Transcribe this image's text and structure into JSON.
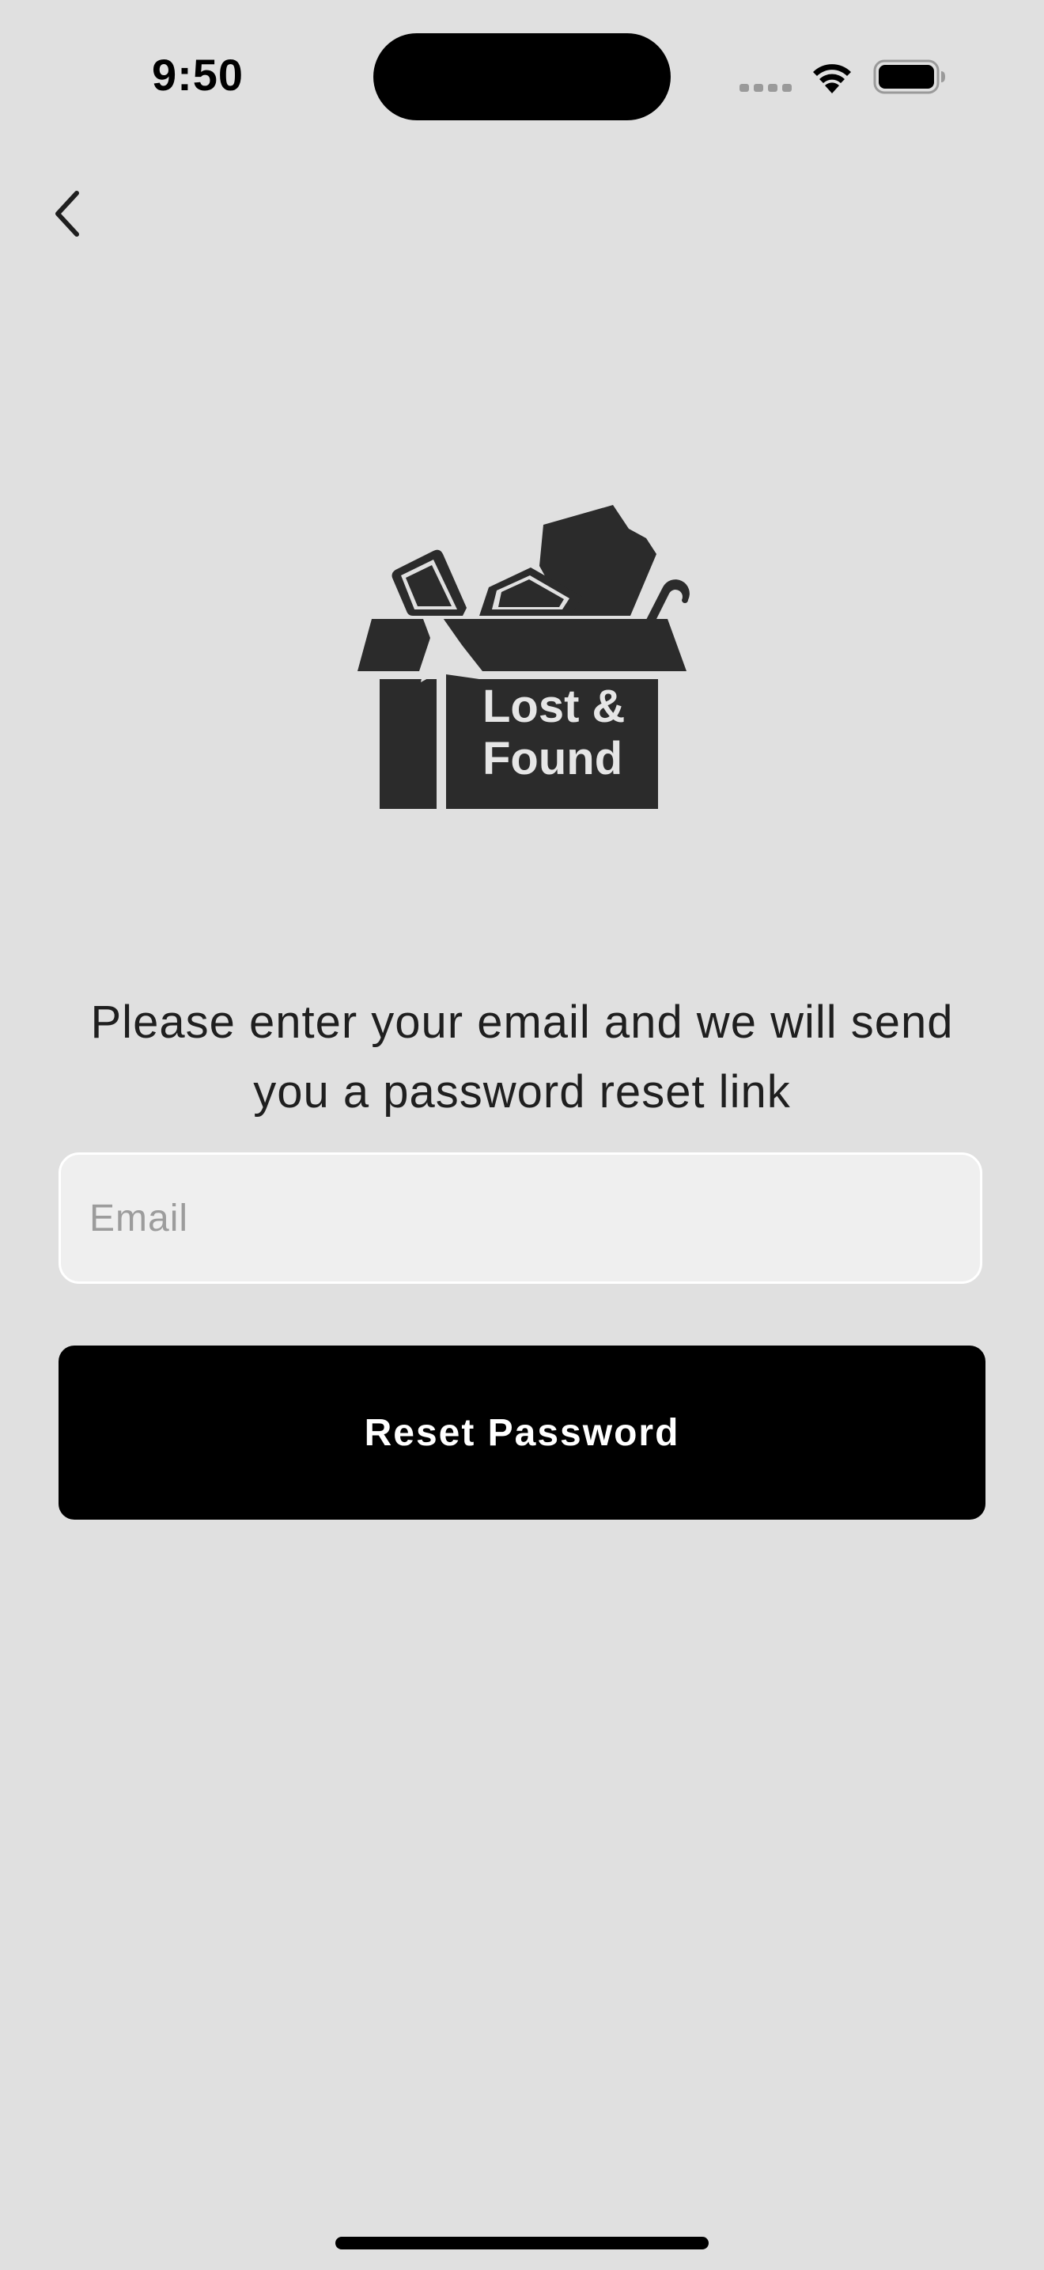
{
  "status_bar": {
    "time": "9:50",
    "icons": [
      "cellular-signal-icon",
      "wifi-icon",
      "battery-icon"
    ]
  },
  "navigation": {
    "back_icon": "chevron-left-icon"
  },
  "logo": {
    "text_line1": "Lost &",
    "text_line2": "Found",
    "icon": "lost-and-found-box-icon"
  },
  "form": {
    "instructions": "Please enter your email and we will send you a password reset link",
    "email_placeholder": "Email",
    "email_value": "",
    "submit_label": "Reset Password"
  },
  "colors": {
    "background": "#e0e0e0",
    "button": "#000000",
    "button_text": "#ffffff",
    "input_background": "#efefef",
    "logo": "#2b2b2b"
  }
}
